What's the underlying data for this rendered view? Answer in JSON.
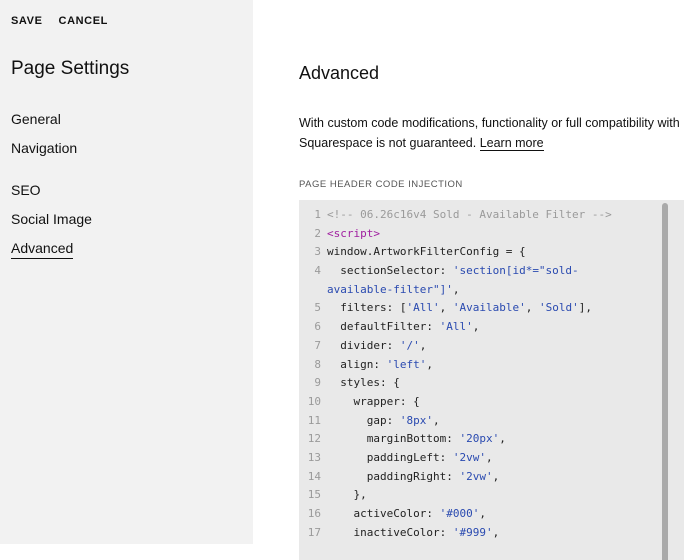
{
  "sidebar": {
    "save_label": "SAVE",
    "cancel_label": "CANCEL",
    "title": "Page Settings",
    "nav": {
      "general": "General",
      "navigation": "Navigation",
      "seo": "SEO",
      "social_image": "Social Image",
      "advanced": "Advanced"
    }
  },
  "main": {
    "title": "Advanced",
    "description_line1": "With custom code modifications, functionality or full compatibility with",
    "description_line2": "Squarespace is not guaranteed.",
    "learn_more": "Learn more",
    "section_label": "PAGE HEADER CODE INJECTION"
  },
  "code_editor": {
    "line_numbers": [
      "1",
      "2",
      "3",
      "4",
      "5",
      "6",
      "7",
      "8",
      "9",
      "10",
      "11",
      "12",
      "13",
      "14",
      "15",
      "16",
      "17"
    ],
    "lines": [
      [
        "<!-- 06.26c16v4 Sold - Available Filter -->"
      ],
      [
        "<script>"
      ],
      [
        "window.ArtworkFilterConfig = {"
      ],
      [
        "  sectionSelector: ",
        "'section[id*=\"sold-"
      ],
      [
        "available-filter\"]'",
        ","
      ],
      [
        "  filters: [",
        "'All'",
        ", ",
        "'Available'",
        ", ",
        "'Sold'",
        "],"
      ],
      [
        "  defaultFilter: ",
        "'All'",
        ","
      ],
      [
        "  divider: ",
        "'/'",
        ","
      ],
      [
        "  align: ",
        "'left'",
        ","
      ],
      [
        "  styles: {"
      ],
      [
        "    wrapper: {"
      ],
      [
        "      gap: ",
        "'8px'",
        ","
      ],
      [
        "      marginBottom: ",
        "'20px'",
        ","
      ],
      [
        "      paddingLeft: ",
        "'2vw'",
        ","
      ],
      [
        "      paddingRight: ",
        "'2vw'",
        ","
      ],
      [
        "    },"
      ],
      [
        "    activeColor: ",
        "'#000'",
        ","
      ],
      [
        "    inactiveColor: ",
        "'#999'",
        ","
      ]
    ]
  }
}
